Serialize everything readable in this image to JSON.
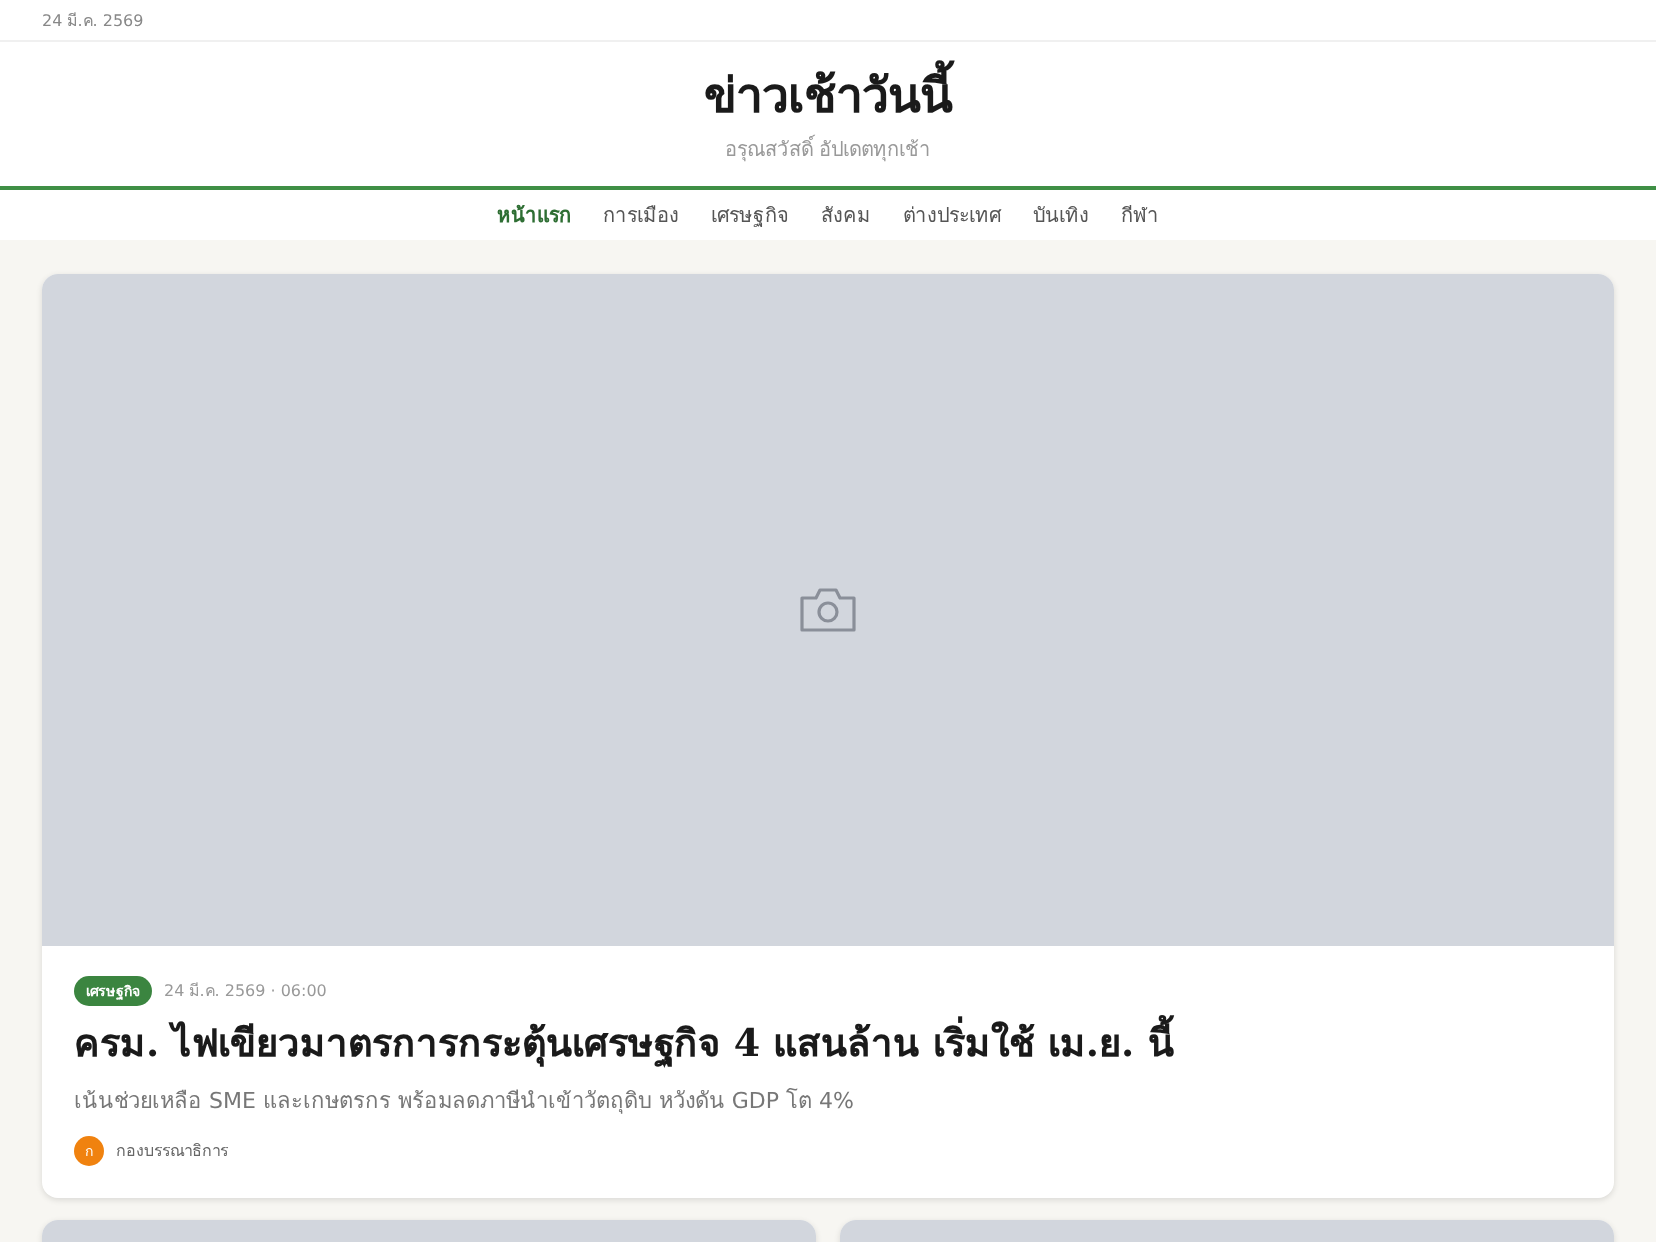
{
  "topbar": {
    "date": "24 มี.ค. 2569"
  },
  "masthead": {
    "title": "ข่าวเช้าวันนี้",
    "tagline": "อรุณสวัสดิ์ อัปเดตทุกเช้า"
  },
  "nav": [
    {
      "label": "หน้าแรก",
      "selected": true
    },
    {
      "label": "การเมือง",
      "selected": false
    },
    {
      "label": "เศรษฐกิจ",
      "selected": false
    },
    {
      "label": "สังคม",
      "selected": false
    },
    {
      "label": "ต่างประเทศ",
      "selected": false
    },
    {
      "label": "บันเทิง",
      "selected": false
    },
    {
      "label": "กีฬา",
      "selected": false
    }
  ],
  "hero": {
    "image": {
      "kind": "placeholder"
    },
    "category": "เศรษฐกิจ",
    "time": "24 มี.ค. 2569 · 06:00",
    "headline": "ครม. ไฟเขียวมาตรการกระตุ้นเศรษฐกิจ 4 แสนล้าน เริ่มใช้ เม.ย. นี้",
    "summary": "เน้นช่วยเหลือ SME และเกษตรกร พร้อมลดภาษีนำเข้าวัตถุดิบ หวังดัน GDP โต 4%",
    "author": {
      "initial": "ก",
      "name": "กองบรรณาธิการ"
    }
  },
  "cards": [
    {
      "image": {
        "kind": "placeholder"
      }
    },
    {
      "image": {
        "kind": "placeholder"
      }
    }
  ]
}
